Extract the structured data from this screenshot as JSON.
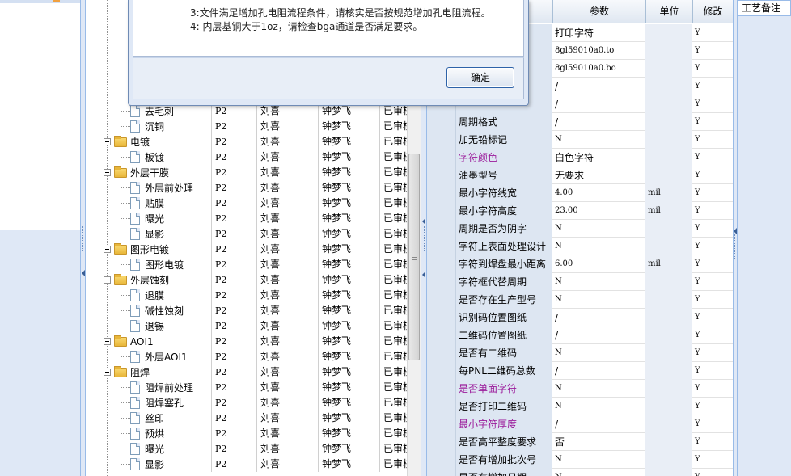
{
  "right_panel": {
    "title": "工艺备注"
  },
  "dialog": {
    "lines": [
      "3:文件满足增加孔电阻流程条件，请核实是否按规范增加孔电阻流程。",
      "4: 内层基铜大于1oz，请检查bga通道是否满足要求。"
    ],
    "ok_label": "确定"
  },
  "tree": {
    "rows": [
      {
        "type": "leaf",
        "name": "去毛刺",
        "level": "P2",
        "author": "刘喜",
        "checker": "钟梦飞",
        "status": "已审核"
      },
      {
        "type": "leaf",
        "name": "沉铜",
        "level": "P2",
        "author": "刘喜",
        "checker": "钟梦飞",
        "status": "已审核"
      },
      {
        "type": "folder",
        "name": "电镀",
        "level": "P2",
        "author": "刘喜",
        "checker": "钟梦飞",
        "status": "已审核"
      },
      {
        "type": "leaf",
        "name": "板镀",
        "level": "P2",
        "author": "刘喜",
        "checker": "钟梦飞",
        "status": "已审核"
      },
      {
        "type": "folder",
        "name": "外层干膜",
        "level": "P2",
        "author": "刘喜",
        "checker": "钟梦飞",
        "status": "已审核"
      },
      {
        "type": "leaf",
        "name": "外层前处理",
        "level": "P2",
        "author": "刘喜",
        "checker": "钟梦飞",
        "status": "已审核"
      },
      {
        "type": "leaf",
        "name": "贴膜",
        "level": "P2",
        "author": "刘喜",
        "checker": "钟梦飞",
        "status": "已审核"
      },
      {
        "type": "leaf",
        "name": "曝光",
        "level": "P2",
        "author": "刘喜",
        "checker": "钟梦飞",
        "status": "已审核"
      },
      {
        "type": "leaf",
        "name": "显影",
        "level": "P2",
        "author": "刘喜",
        "checker": "钟梦飞",
        "status": "已审核"
      },
      {
        "type": "folder",
        "name": "图形电镀",
        "level": "P2",
        "author": "刘喜",
        "checker": "钟梦飞",
        "status": "已审核"
      },
      {
        "type": "leaf",
        "name": "图形电镀",
        "level": "P2",
        "author": "刘喜",
        "checker": "钟梦飞",
        "status": "已审核"
      },
      {
        "type": "folder",
        "name": "外层蚀刻",
        "level": "P2",
        "author": "刘喜",
        "checker": "钟梦飞",
        "status": "已审核"
      },
      {
        "type": "leaf",
        "name": "退膜",
        "level": "P2",
        "author": "刘喜",
        "checker": "钟梦飞",
        "status": "已审核"
      },
      {
        "type": "leaf",
        "name": "碱性蚀刻",
        "level": "P2",
        "author": "刘喜",
        "checker": "钟梦飞",
        "status": "已审核"
      },
      {
        "type": "leaf",
        "name": "退锡",
        "level": "P2",
        "author": "刘喜",
        "checker": "钟梦飞",
        "status": "已审核"
      },
      {
        "type": "folder",
        "name": "AOI1",
        "level": "P2",
        "author": "刘喜",
        "checker": "钟梦飞",
        "status": "已审核"
      },
      {
        "type": "leaf",
        "name": "外层AOI1",
        "level": "P2",
        "author": "刘喜",
        "checker": "钟梦飞",
        "status": "已审核"
      },
      {
        "type": "folder",
        "name": "阻焊",
        "level": "P2",
        "author": "刘喜",
        "checker": "钟梦飞",
        "status": "已审核"
      },
      {
        "type": "leaf",
        "name": "阻焊前处理",
        "level": "P2",
        "author": "刘喜",
        "checker": "钟梦飞",
        "status": "已审核"
      },
      {
        "type": "leaf",
        "name": "阻焊塞孔",
        "level": "P2",
        "author": "刘喜",
        "checker": "钟梦飞",
        "status": "已审核"
      },
      {
        "type": "leaf",
        "name": "丝印",
        "level": "P2",
        "author": "刘喜",
        "checker": "钟梦飞",
        "status": "已审核"
      },
      {
        "type": "leaf",
        "name": "预烘",
        "level": "P2",
        "author": "刘喜",
        "checker": "钟梦飞",
        "status": "已审核"
      },
      {
        "type": "leaf",
        "name": "曝光",
        "level": "P2",
        "author": "刘喜",
        "checker": "钟梦飞",
        "status": "已审核"
      },
      {
        "type": "leaf",
        "name": "显影",
        "level": "P2",
        "author": "刘喜",
        "checker": "钟梦飞",
        "status": "已审核"
      }
    ]
  },
  "grid": {
    "headers": {
      "param": "参数",
      "unit": "单位",
      "modify": "修改"
    },
    "rows": [
      {
        "name": "",
        "value": "打印字符",
        "unit": "",
        "mod": "Y",
        "purple": false
      },
      {
        "name": "",
        "value": "8gl59010a0.to",
        "unit": "",
        "mod": "Y",
        "purple": false
      },
      {
        "name": "",
        "value": "8gl59010a0.bo",
        "unit": "",
        "mod": "Y",
        "purple": false
      },
      {
        "name": "",
        "value": "/",
        "unit": "",
        "mod": "Y",
        "purple": false
      },
      {
        "name": "",
        "value": "/",
        "unit": "",
        "mod": "Y",
        "purple": false
      },
      {
        "name": "周期格式",
        "value": "/",
        "unit": "",
        "mod": "Y",
        "purple": false
      },
      {
        "name": "加无铅标记",
        "value": "N",
        "unit": "",
        "mod": "Y",
        "purple": false
      },
      {
        "name": "字符颜色",
        "value": "白色字符",
        "unit": "",
        "mod": "Y",
        "purple": true
      },
      {
        "name": "油墨型号",
        "value": "无要求",
        "unit": "",
        "mod": "Y",
        "purple": false
      },
      {
        "name": "最小字符线宽",
        "value": "4.00",
        "unit": "mil",
        "mod": "Y",
        "purple": false
      },
      {
        "name": "最小字符高度",
        "value": "23.00",
        "unit": "mil",
        "mod": "Y",
        "purple": false
      },
      {
        "name": "周期是否为阴字",
        "value": "N",
        "unit": "",
        "mod": "Y",
        "purple": false
      },
      {
        "name": "字符上表面处理设计",
        "value": "N",
        "unit": "",
        "mod": "Y",
        "purple": false
      },
      {
        "name": "字符到焊盘最小距离",
        "value": "6.00",
        "unit": "mil",
        "mod": "Y",
        "purple": false
      },
      {
        "name": "字符框代替周期",
        "value": "N",
        "unit": "",
        "mod": "Y",
        "purple": false
      },
      {
        "name": "是否存在生产型号",
        "value": "N",
        "unit": "",
        "mod": "Y",
        "purple": false
      },
      {
        "name": "识别码位置图纸",
        "value": "/",
        "unit": "",
        "mod": "Y",
        "purple": false
      },
      {
        "name": "二维码位置图纸",
        "value": "/",
        "unit": "",
        "mod": "Y",
        "purple": false
      },
      {
        "name": "是否有二维码",
        "value": "N",
        "unit": "",
        "mod": "Y",
        "purple": false
      },
      {
        "name": "每PNL二维码总数",
        "value": "/",
        "unit": "",
        "mod": "Y",
        "purple": false
      },
      {
        "name": "是否单面字符",
        "value": "N",
        "unit": "",
        "mod": "Y",
        "purple": true
      },
      {
        "name": "是否打印二维码",
        "value": "N",
        "unit": "",
        "mod": "Y",
        "purple": false
      },
      {
        "name": "最小字符厚度",
        "value": "/",
        "unit": "",
        "mod": "Y",
        "purple": true
      },
      {
        "name": "是否高平整度要求",
        "value": "否",
        "unit": "",
        "mod": "Y",
        "purple": false
      },
      {
        "name": "是否有增加批次号",
        "value": "N",
        "unit": "",
        "mod": "Y",
        "purple": false
      },
      {
        "name": "是否有增加日期",
        "value": "N",
        "unit": "",
        "mod": "Y",
        "purple": false
      }
    ]
  }
}
